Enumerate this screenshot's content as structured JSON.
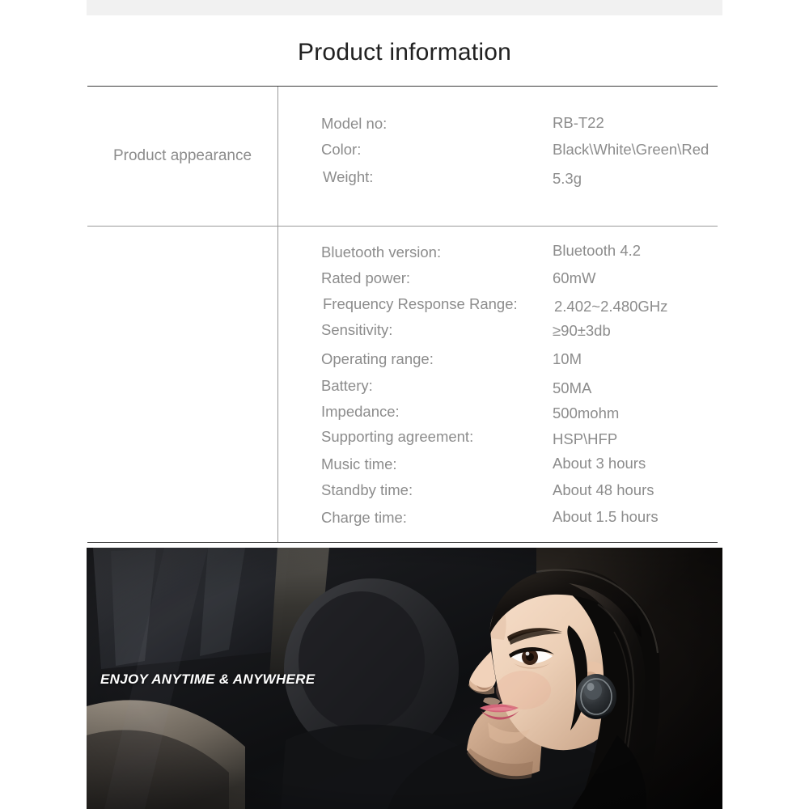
{
  "page": {
    "title": "Product information",
    "title_color": "#212121",
    "label_color": "#8c8c8c",
    "rule_color": "#3c3c3c",
    "strip_color": "#f1f1f1"
  },
  "table": {
    "rows": [
      {
        "row_label": "Product appearance",
        "attributes": [
          {
            "key": "Model no:",
            "value": "RB-T22"
          },
          {
            "key": "Color:",
            "value": "Black\\White\\Green\\Red"
          },
          {
            "key": "Weight:",
            "value": "5.3g"
          }
        ]
      },
      {
        "row_label": "",
        "attributes": [
          {
            "key": "Bluetooth version:",
            "value": "Bluetooth 4.2"
          },
          {
            "key": "Rated power:",
            "value": "60mW"
          },
          {
            "key": "Frequency Response Range:",
            "value": "2.402~2.480GHz"
          },
          {
            "key": "Sensitivity:",
            "value": "≥90±3db"
          },
          {
            "key": "Operating range:",
            "value": "10M"
          },
          {
            "key": "Battery:",
            "value": "50MA"
          },
          {
            "key": "Impedance:",
            "value": "500mohm"
          },
          {
            "key": "Supporting agreement:",
            "value": "HSP\\HFP"
          },
          {
            "key": "Music time:",
            "value": "About 3 hours"
          },
          {
            "key": "Standby time:",
            "value": "About 48 hours"
          },
          {
            "key": "Charge time:",
            "value": "About 1.5 hours"
          }
        ]
      }
    ]
  },
  "hero": {
    "caption": "ENJOY ANYTIME & ANYWHERE",
    "scene_description": "Woman in car profile view wearing a black wireless earbud",
    "caption_color": "#ffffff"
  }
}
